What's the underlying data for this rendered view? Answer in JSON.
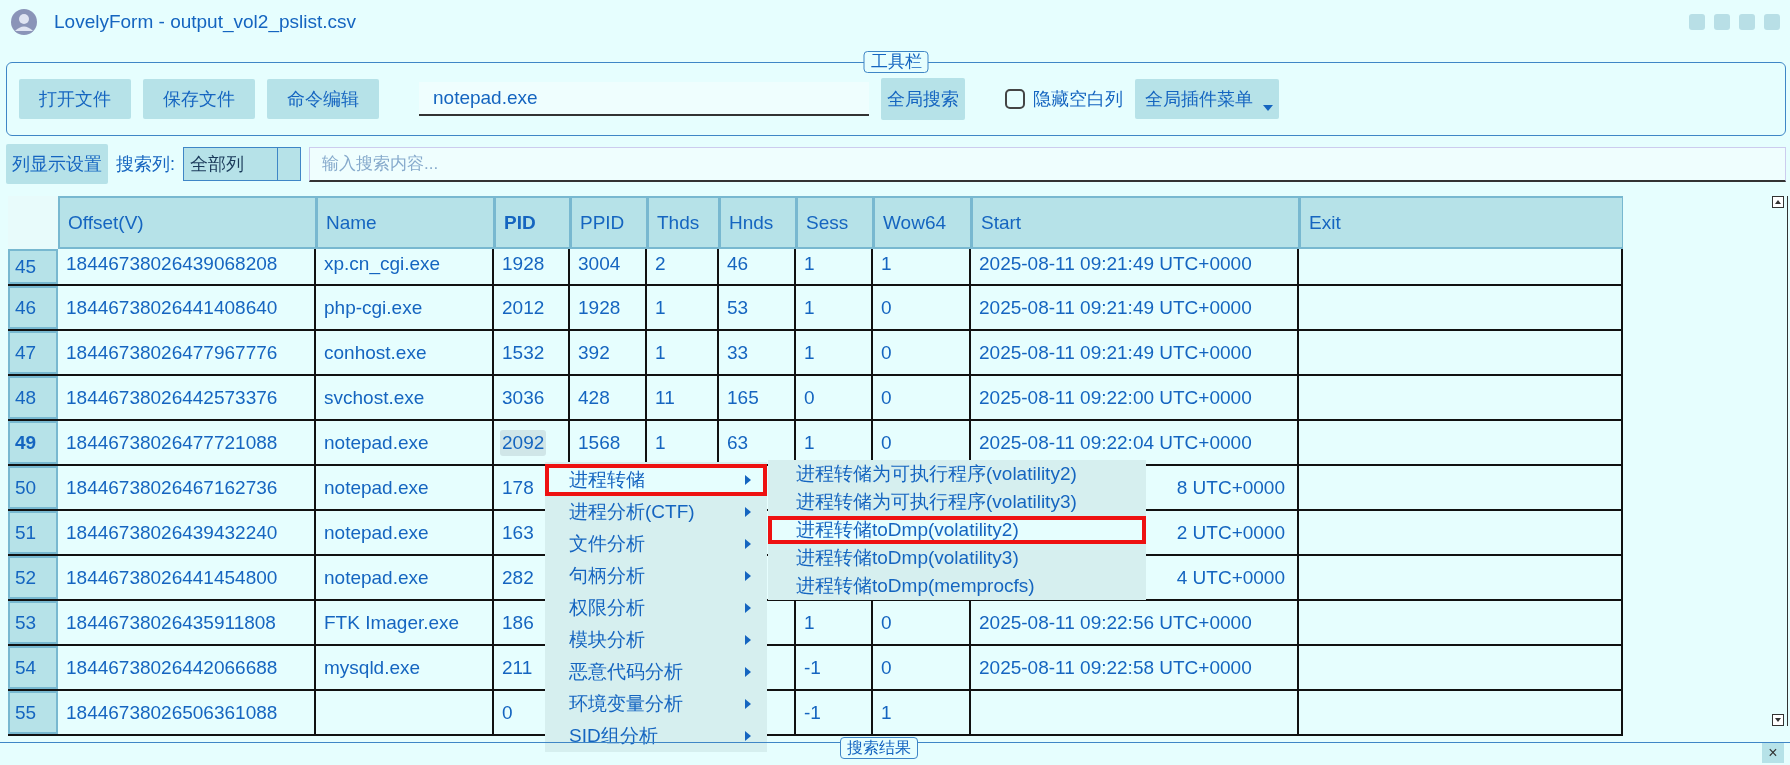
{
  "window": {
    "title": "LovelyForm - output_vol2_pslist.csv"
  },
  "toolbar": {
    "legend": "工具栏",
    "buttons": [
      "打开文件",
      "保存文件",
      "命令编辑"
    ],
    "search": {
      "value": "notepad.exe"
    },
    "search_button": "全局搜索",
    "hide_empty": {
      "label": "隐藏空白列",
      "checked": false
    },
    "plugin_menu": "全局插件菜单"
  },
  "filter_bar": {
    "column_settings": "列显示设置",
    "search_column_label": "搜索列:",
    "search_column": "全部列",
    "search": {
      "placeholder": "输入搜索内容..."
    }
  },
  "table": {
    "columns": [
      {
        "label": "Offset(V)",
        "selected": false
      },
      {
        "label": "Name",
        "selected": false
      },
      {
        "label": "PID",
        "selected": true
      },
      {
        "label": "PPID",
        "selected": false
      },
      {
        "label": "Thds",
        "selected": false
      },
      {
        "label": "Hnds",
        "selected": false
      },
      {
        "label": "Sess",
        "selected": false
      },
      {
        "label": "Wow64",
        "selected": false
      },
      {
        "label": "Start",
        "selected": false
      },
      {
        "label": "Exit",
        "selected": false
      }
    ],
    "rows": [
      {
        "index": "45",
        "current": false,
        "start_covered": false,
        "cells": [
          "18446738026439068208",
          "xp.cn_cgi.exe",
          "1928",
          "3004",
          "2",
          "46",
          "1",
          "1",
          "2025-08-11 09:21:49 UTC+0000",
          null
        ]
      },
      {
        "index": "46",
        "current": false,
        "start_covered": false,
        "cells": [
          "18446738026441408640",
          "php-cgi.exe",
          "2012",
          "1928",
          "1",
          "53",
          "1",
          "0",
          "2025-08-11 09:21:49 UTC+0000",
          null
        ]
      },
      {
        "index": "47",
        "current": false,
        "start_covered": false,
        "cells": [
          "18446738026477967776",
          "conhost.exe",
          "1532",
          "392",
          "1",
          "33",
          "1",
          "0",
          "2025-08-11 09:21:49 UTC+0000",
          null
        ]
      },
      {
        "index": "48",
        "current": false,
        "start_covered": false,
        "cells": [
          "18446738026442573376",
          "svchost.exe",
          "3036",
          "428",
          "11",
          "165",
          "0",
          "0",
          "2025-08-11 09:22:00 UTC+0000",
          null
        ]
      },
      {
        "index": "49",
        "current": true,
        "start_covered": false,
        "cells": [
          "18446738026477721088",
          "notepad.exe",
          "2092",
          "1568",
          "1",
          "63",
          "1",
          "0",
          "2025-08-11 09:22:04 UTC+0000",
          null
        ]
      },
      {
        "index": "50",
        "current": false,
        "start_covered": true,
        "cells": [
          "18446738026467162736",
          "notepad.exe",
          "178",
          null,
          null,
          null,
          null,
          null,
          "8 UTC+0000",
          null
        ]
      },
      {
        "index": "51",
        "current": false,
        "start_covered": true,
        "cells": [
          "18446738026439432240",
          "notepad.exe",
          "163",
          null,
          null,
          null,
          null,
          null,
          "2 UTC+0000",
          null
        ]
      },
      {
        "index": "52",
        "current": false,
        "start_covered": true,
        "cells": [
          "18446738026441454800",
          "notepad.exe",
          "282",
          null,
          null,
          null,
          null,
          null,
          "4 UTC+0000",
          null
        ]
      },
      {
        "index": "53",
        "current": false,
        "start_covered": false,
        "cells": [
          "18446738026435911808",
          "FTK Imager.exe",
          "186",
          null,
          null,
          null,
          "1",
          "0",
          "2025-08-11 09:22:56 UTC+0000",
          null
        ]
      },
      {
        "index": "54",
        "current": false,
        "start_covered": false,
        "cells": [
          "18446738026442066688",
          "mysqld.exe",
          "211",
          null,
          null,
          null,
          "-1",
          "0",
          "2025-08-11 09:22:58 UTC+0000",
          null
        ]
      },
      {
        "index": "55",
        "current": false,
        "cells": [
          "18446738026506361088",
          null,
          "0",
          null,
          null,
          null,
          "-1",
          "1",
          null,
          null
        ]
      }
    ]
  },
  "context_menu": {
    "items": [
      {
        "label": "进程转储",
        "selected": true,
        "has_submenu": true
      },
      {
        "label": "进程分析(CTF)",
        "selected": false,
        "has_submenu": true
      },
      {
        "label": "文件分析",
        "selected": false,
        "has_submenu": true
      },
      {
        "label": "句柄分析",
        "selected": false,
        "has_submenu": true
      },
      {
        "label": "权限分析",
        "selected": false,
        "has_submenu": true
      },
      {
        "label": "模块分析",
        "selected": false,
        "has_submenu": true
      },
      {
        "label": "恶意代码分析",
        "selected": false,
        "has_submenu": true
      },
      {
        "label": "环境变量分析",
        "selected": false,
        "has_submenu": true
      },
      {
        "label": "SID组分析",
        "selected": false,
        "has_submenu": true
      }
    ],
    "submenu": {
      "items": [
        {
          "label": "进程转储为可执行程序(volatility2)",
          "selected": false
        },
        {
          "label": "进程转储为可执行程序(volatility3)",
          "selected": false
        },
        {
          "label": "进程转储toDmp(volatility2)",
          "selected": true
        },
        {
          "label": "进程转储toDmp(volatility3)",
          "selected": false
        },
        {
          "label": "进程转储toDmp(memprocfs)",
          "selected": false
        }
      ]
    }
  },
  "bottom_panel": {
    "tab": "搜索结果",
    "close": "×"
  }
}
